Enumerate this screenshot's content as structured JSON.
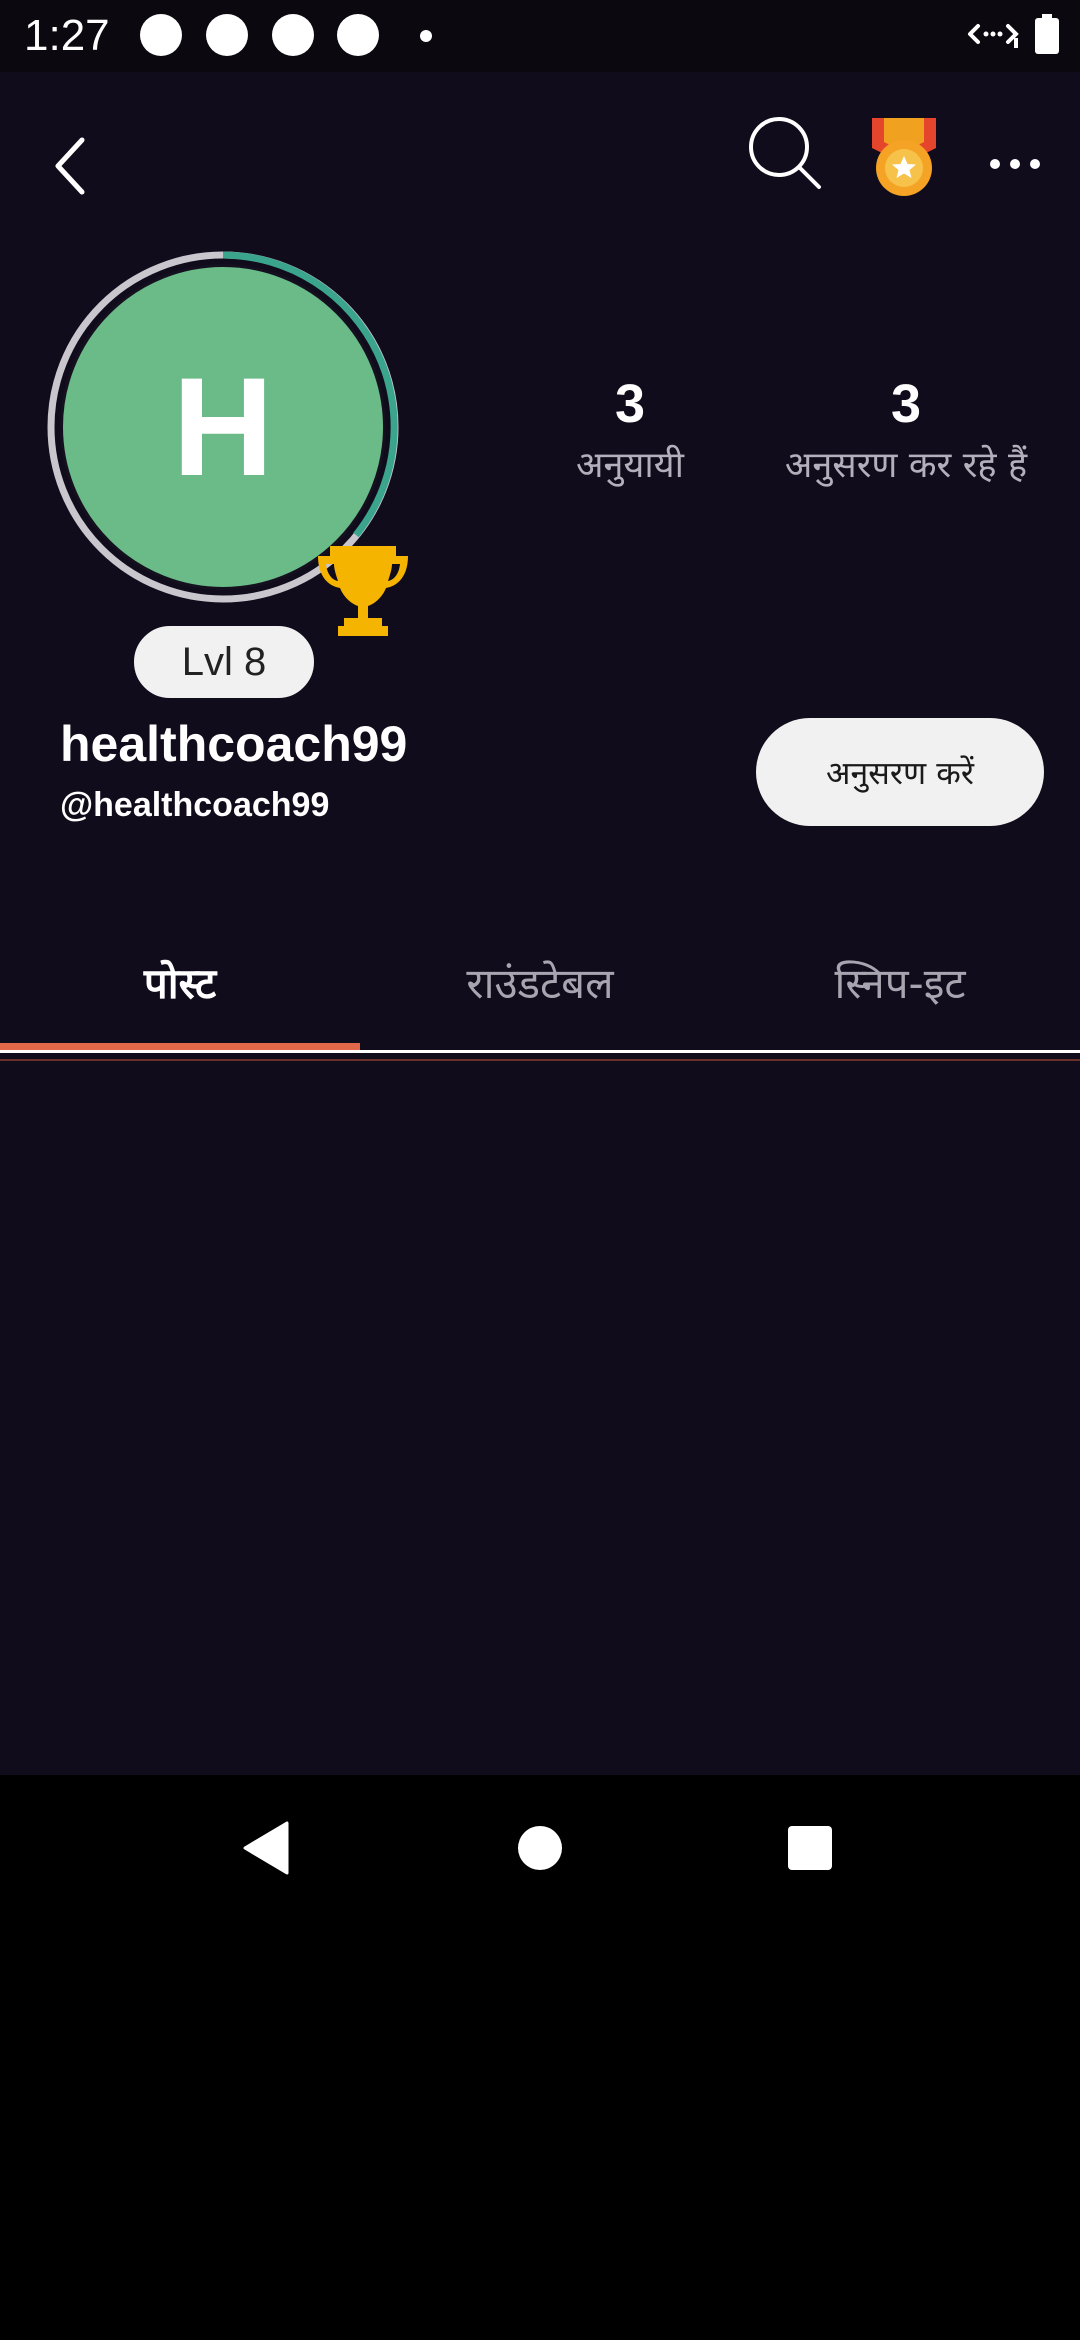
{
  "status_bar": {
    "time": "1:27",
    "icons": [
      "notification-dot",
      "notification-dot",
      "notification-dot",
      "notification-dot",
      "small-dot",
      "wifi-data-icon",
      "battery-icon"
    ]
  },
  "header": {
    "icons": [
      "back-arrow-icon",
      "search-icon",
      "medal-icon",
      "more-options-icon"
    ]
  },
  "profile": {
    "avatar_letter": "H",
    "avatar_color": "#6abb88",
    "level_label": "Lvl 8",
    "username": "healthcoach99",
    "handle": "@healthcoach99",
    "followers_count": "3",
    "followers_label": "अनुयायी",
    "following_count": "3",
    "following_label": "अनुसरण कर रहे हैं",
    "follow_button_label": "अनुसरण करें"
  },
  "tabs": [
    {
      "label": "पोस्ट",
      "active": true
    },
    {
      "label": "राउंडटेबल",
      "active": false
    },
    {
      "label": "स्निप-इट",
      "active": false
    }
  ],
  "colors": {
    "background": "#110c1c",
    "accent": "#e2684a",
    "trophy": "#f4b400",
    "ring_teal": "#3aa58c",
    "ring_gray": "#c9c6cd"
  },
  "nav_bar": {
    "icons": [
      "back-triangle-icon",
      "home-circle-icon",
      "recents-square-icon"
    ]
  }
}
